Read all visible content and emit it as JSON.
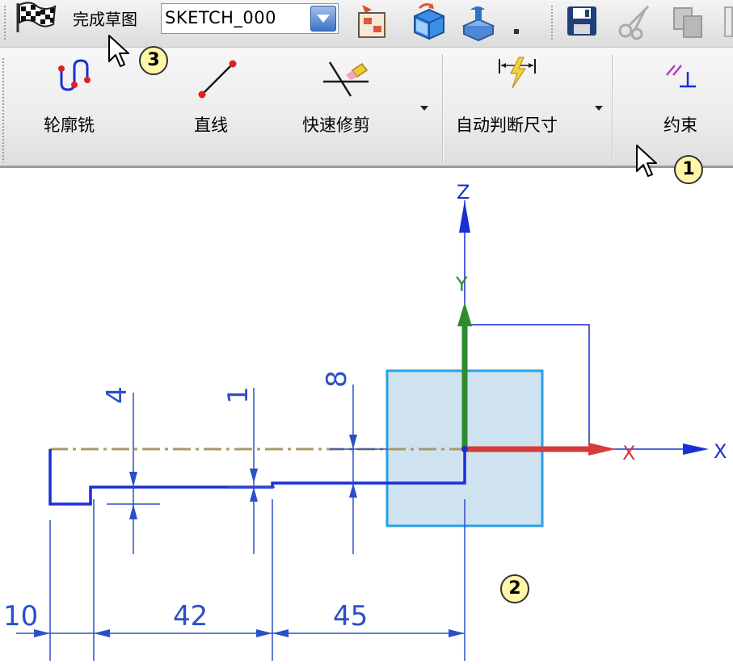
{
  "toolbar": {
    "finish_sketch_label": "完成草图",
    "sketch_name": "SKETCH_000"
  },
  "ribbon": {
    "profile_mill_label": "轮廓铣",
    "line_label": "直线",
    "quick_trim_label": "快速修剪",
    "auto_dimension_label": "自动判断尺寸",
    "constraint_label": "约束"
  },
  "callouts": {
    "c1": "1",
    "c2": "2",
    "c3": "3"
  },
  "sketch": {
    "dimensions": {
      "d_4": "4",
      "d_1": "1",
      "d_8": "8",
      "d_10": "10",
      "d_42": "42",
      "d_45": "45"
    },
    "axes": {
      "z_label": "Z",
      "y_label": "Y",
      "x_label": "X",
      "x_label_red": "X"
    },
    "colors": {
      "profile": "#1a2fd6",
      "dimension": "#2a50c8",
      "centerline": "#a89a6a",
      "plane_fill": "#cfe2f0",
      "plane_border": "#2aa0e6",
      "x_axis": "#d63a3a",
      "y_axis": "#2e8c2e"
    }
  }
}
